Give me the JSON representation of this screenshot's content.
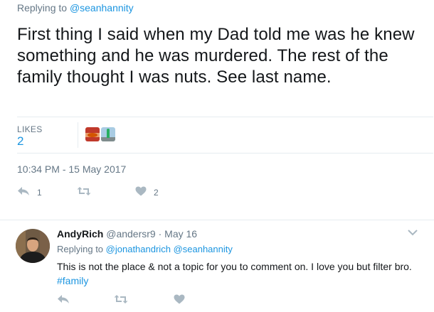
{
  "main_tweet": {
    "reply_prefix": "Replying to",
    "reply_handle": "@seanhannity",
    "text": "First thing I said when my Dad told me was he knew something and he was murdered. The rest of the family thought I was nuts. See last name.",
    "likes_label": "LIKES",
    "likes_count": "2",
    "timestamp": "10:34 PM - 15 May 2017",
    "reply_count": "1",
    "retweet_count": "",
    "like_count": "2"
  },
  "reply_tweet": {
    "name": "AndyRich",
    "handle": "@andersr9",
    "separator": "·",
    "date": "May 16",
    "reply_prefix": "Replying to",
    "reply_handle_1": "@jonathandrich",
    "reply_handle_2": "@seanhannity",
    "text": "This is not the place & not a topic for you to comment on. I love you but filter bro.",
    "hashtag": "#family"
  },
  "icons": {
    "reply": "reply-icon",
    "retweet": "retweet-icon",
    "like": "heart-icon",
    "menu": "chevron-down-icon"
  },
  "colors": {
    "link": "#1b95e0",
    "muted": "#657786",
    "icon": "#aab8c2"
  }
}
